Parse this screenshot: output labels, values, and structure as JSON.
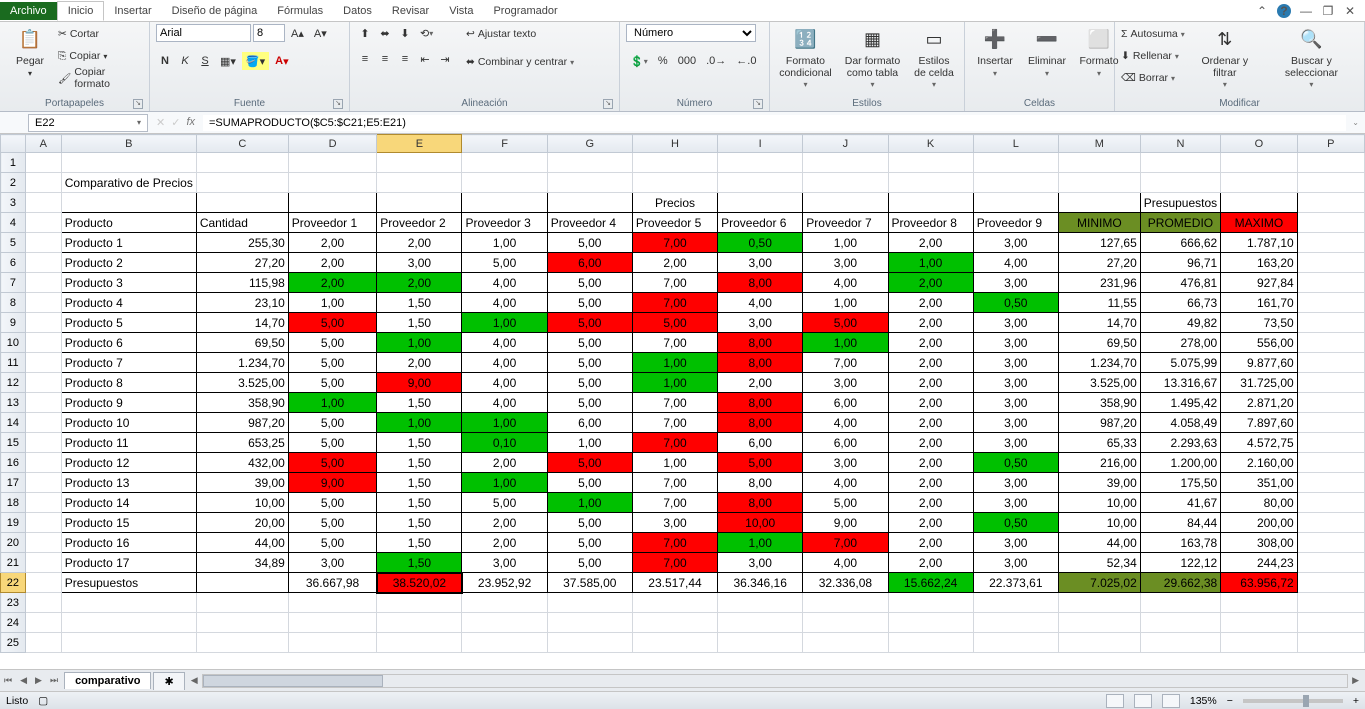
{
  "tabs": {
    "file": "Archivo",
    "home": "Inicio",
    "insert": "Insertar",
    "layout": "Diseño de página",
    "formulas": "Fórmulas",
    "data": "Datos",
    "review": "Revisar",
    "view": "Vista",
    "dev": "Programador"
  },
  "ribbon": {
    "clipboard": {
      "paste": "Pegar",
      "cut": "Cortar",
      "copy": "Copiar",
      "fmtpaint": "Copiar formato",
      "label": "Portapapeles"
    },
    "font": {
      "name": "Arial",
      "size": "8",
      "bold": "N",
      "italic": "K",
      "underline": "S",
      "label": "Fuente"
    },
    "align": {
      "wrap": "Ajustar texto",
      "merge": "Combinar y centrar",
      "label": "Alineación"
    },
    "number": {
      "cat": "Número",
      "label": "Número"
    },
    "styles": {
      "cond": "Formato condicional",
      "table": "Dar formato como tabla",
      "cell": "Estilos de celda",
      "label": "Estilos"
    },
    "cells": {
      "insert": "Insertar",
      "delete": "Eliminar",
      "format": "Formato",
      "label": "Celdas"
    },
    "editing": {
      "sum": "Autosuma",
      "fill": "Rellenar",
      "clear": "Borrar",
      "sort": "Ordenar y filtrar",
      "find": "Buscar y seleccionar",
      "label": "Modificar"
    }
  },
  "formula": {
    "cell": "E22",
    "fx": "=SUMAPRODUCTO($C5:$C21;E5:E21)"
  },
  "cols": [
    "A",
    "B",
    "C",
    "D",
    "E",
    "F",
    "G",
    "H",
    "I",
    "J",
    "K",
    "L",
    "M",
    "N",
    "O",
    "P"
  ],
  "title": "Comparativo de Precios",
  "hdr": {
    "precios": "Precios",
    "presup": "Presupuestos",
    "prod": "Producto",
    "cant": "Cantidad",
    "prov": [
      "Proveedor 1",
      "Proveedor 2",
      "Proveedor 3",
      "Proveedor 4",
      "Proveedor 5",
      "Proveedor 6",
      "Proveedor 7",
      "Proveedor 8",
      "Proveedor 9"
    ],
    "min": "MINIMO",
    "avg": "PROMEDIO",
    "max": "MAXIMO"
  },
  "rows": [
    {
      "p": "Producto 1",
      "c": "255,30",
      "v": [
        "2,00",
        "2,00",
        "1,00",
        "5,00",
        "7,00",
        "0,50",
        "1,00",
        "2,00",
        "3,00"
      ],
      "s": [
        "",
        "",
        "",
        "",
        "red",
        "green",
        "",
        "",
        ""
      ],
      "m": "127,65",
      "a": "666,62",
      "x": "1.787,10"
    },
    {
      "p": "Producto 2",
      "c": "27,20",
      "v": [
        "2,00",
        "3,00",
        "5,00",
        "6,00",
        "2,00",
        "3,00",
        "3,00",
        "1,00",
        "4,00"
      ],
      "s": [
        "",
        "",
        "",
        "red",
        "",
        "",
        "",
        "green",
        ""
      ],
      "m": "27,20",
      "a": "96,71",
      "x": "163,20"
    },
    {
      "p": "Producto 3",
      "c": "115,98",
      "v": [
        "2,00",
        "2,00",
        "4,00",
        "5,00",
        "7,00",
        "8,00",
        "4,00",
        "2,00",
        "3,00"
      ],
      "s": [
        "green",
        "green",
        "",
        "",
        "",
        "red",
        "",
        "green",
        ""
      ],
      "m": "231,96",
      "a": "476,81",
      "x": "927,84"
    },
    {
      "p": "Producto 4",
      "c": "23,10",
      "v": [
        "1,00",
        "1,50",
        "4,00",
        "5,00",
        "7,00",
        "4,00",
        "1,00",
        "2,00",
        "0,50"
      ],
      "s": [
        "",
        "",
        "",
        "",
        "red",
        "",
        "",
        "",
        "green"
      ],
      "m": "11,55",
      "a": "66,73",
      "x": "161,70"
    },
    {
      "p": "Producto 5",
      "c": "14,70",
      "v": [
        "5,00",
        "1,50",
        "1,00",
        "5,00",
        "5,00",
        "3,00",
        "5,00",
        "2,00",
        "3,00"
      ],
      "s": [
        "red",
        "",
        "green",
        "red",
        "red",
        "",
        "red",
        "",
        ""
      ],
      "m": "14,70",
      "a": "49,82",
      "x": "73,50"
    },
    {
      "p": "Producto 6",
      "c": "69,50",
      "v": [
        "5,00",
        "1,00",
        "4,00",
        "5,00",
        "7,00",
        "8,00",
        "1,00",
        "2,00",
        "3,00"
      ],
      "s": [
        "",
        "green",
        "",
        "",
        "",
        "red",
        "green",
        "",
        ""
      ],
      "m": "69,50",
      "a": "278,00",
      "x": "556,00"
    },
    {
      "p": "Producto 7",
      "c": "1.234,70",
      "v": [
        "5,00",
        "2,00",
        "4,00",
        "5,00",
        "1,00",
        "8,00",
        "7,00",
        "2,00",
        "3,00"
      ],
      "s": [
        "",
        "",
        "",
        "",
        "green",
        "red",
        "",
        "",
        ""
      ],
      "m": "1.234,70",
      "a": "5.075,99",
      "x": "9.877,60"
    },
    {
      "p": "Producto 8",
      "c": "3.525,00",
      "v": [
        "5,00",
        "9,00",
        "4,00",
        "5,00",
        "1,00",
        "2,00",
        "3,00",
        "2,00",
        "3,00"
      ],
      "s": [
        "",
        "red",
        "",
        "",
        "green",
        "",
        "",
        "",
        ""
      ],
      "m": "3.525,00",
      "a": "13.316,67",
      "x": "31.725,00"
    },
    {
      "p": "Producto 9",
      "c": "358,90",
      "v": [
        "1,00",
        "1,50",
        "4,00",
        "5,00",
        "7,00",
        "8,00",
        "6,00",
        "2,00",
        "3,00"
      ],
      "s": [
        "green",
        "",
        "",
        "",
        "",
        "red",
        "",
        "",
        ""
      ],
      "m": "358,90",
      "a": "1.495,42",
      "x": "2.871,20"
    },
    {
      "p": "Producto 10",
      "c": "987,20",
      "v": [
        "5,00",
        "1,00",
        "1,00",
        "6,00",
        "7,00",
        "8,00",
        "4,00",
        "2,00",
        "3,00"
      ],
      "s": [
        "",
        "green",
        "green",
        "",
        "",
        "red",
        "",
        "",
        ""
      ],
      "m": "987,20",
      "a": "4.058,49",
      "x": "7.897,60"
    },
    {
      "p": "Producto 11",
      "c": "653,25",
      "v": [
        "5,00",
        "1,50",
        "0,10",
        "1,00",
        "7,00",
        "6,00",
        "6,00",
        "2,00",
        "3,00"
      ],
      "s": [
        "",
        "",
        "green",
        "",
        "red",
        "",
        "",
        "",
        ""
      ],
      "m": "65,33",
      "a": "2.293,63",
      "x": "4.572,75"
    },
    {
      "p": "Producto 12",
      "c": "432,00",
      "v": [
        "5,00",
        "1,50",
        "2,00",
        "5,00",
        "1,00",
        "5,00",
        "3,00",
        "2,00",
        "0,50"
      ],
      "s": [
        "red",
        "",
        "",
        "red",
        "",
        "red",
        "",
        "",
        "green"
      ],
      "m": "216,00",
      "a": "1.200,00",
      "x": "2.160,00"
    },
    {
      "p": "Producto 13",
      "c": "39,00",
      "v": [
        "9,00",
        "1,50",
        "1,00",
        "5,00",
        "7,00",
        "8,00",
        "4,00",
        "2,00",
        "3,00"
      ],
      "s": [
        "red",
        "",
        "green",
        "",
        "",
        "",
        "",
        "",
        ""
      ],
      "m": "39,00",
      "a": "175,50",
      "x": "351,00"
    },
    {
      "p": "Producto 14",
      "c": "10,00",
      "v": [
        "5,00",
        "1,50",
        "5,00",
        "1,00",
        "7,00",
        "8,00",
        "5,00",
        "2,00",
        "3,00"
      ],
      "s": [
        "",
        "",
        "",
        "green",
        "",
        "red",
        "",
        "",
        ""
      ],
      "m": "10,00",
      "a": "41,67",
      "x": "80,00"
    },
    {
      "p": "Producto 15",
      "c": "20,00",
      "v": [
        "5,00",
        "1,50",
        "2,00",
        "5,00",
        "3,00",
        "10,00",
        "9,00",
        "2,00",
        "0,50"
      ],
      "s": [
        "",
        "",
        "",
        "",
        "",
        "red",
        "",
        "",
        "green"
      ],
      "m": "10,00",
      "a": "84,44",
      "x": "200,00"
    },
    {
      "p": "Producto 16",
      "c": "44,00",
      "v": [
        "5,00",
        "1,50",
        "2,00",
        "5,00",
        "7,00",
        "1,00",
        "7,00",
        "2,00",
        "3,00"
      ],
      "s": [
        "",
        "",
        "",
        "",
        "red",
        "green",
        "red",
        "",
        ""
      ],
      "m": "44,00",
      "a": "163,78",
      "x": "308,00"
    },
    {
      "p": "Producto 17",
      "c": "34,89",
      "v": [
        "3,00",
        "1,50",
        "3,00",
        "5,00",
        "7,00",
        "3,00",
        "4,00",
        "2,00",
        "3,00"
      ],
      "s": [
        "",
        "green",
        "",
        "",
        "red",
        "",
        "",
        "",
        ""
      ],
      "m": "52,34",
      "a": "122,12",
      "x": "244,23"
    }
  ],
  "tot": {
    "label": "Presupuestos",
    "v": [
      "36.667,98",
      "38.520,02",
      "23.952,92",
      "37.585,00",
      "23.517,44",
      "36.346,16",
      "32.336,08",
      "15.662,24",
      "22.373,61"
    ],
    "s": [
      "",
      "red",
      "",
      "",
      "",
      "",
      "",
      "green",
      ""
    ],
    "m": "7.025,02",
    "a": "29.662,38",
    "x": "63.956,72"
  },
  "sheet": {
    "tab": "comparativo"
  },
  "status": {
    "ready": "Listo",
    "zoom": "135%"
  }
}
